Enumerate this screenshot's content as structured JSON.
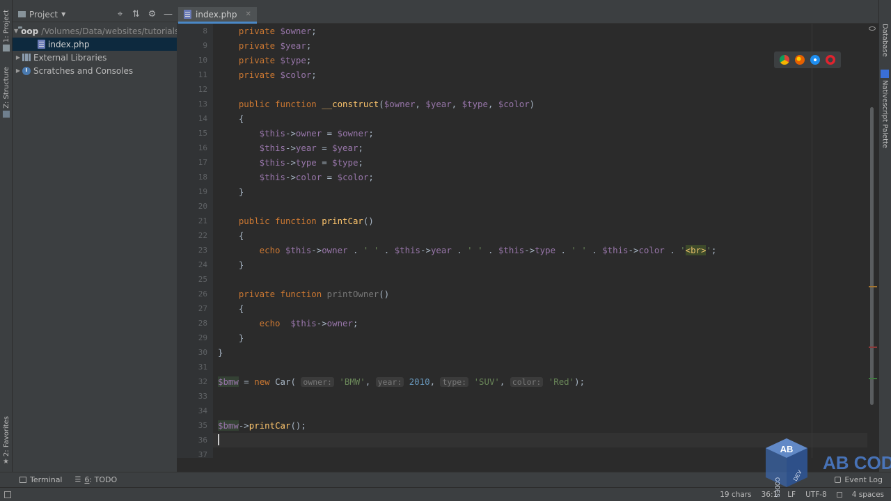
{
  "project_panel": {
    "title": "Project",
    "tree": [
      {
        "name": "oop",
        "path": "/Volumes/Data/websites/tutorials/",
        "type": "folder",
        "expanded": true
      },
      {
        "name": "index.php",
        "type": "php",
        "selected": true
      },
      {
        "name": "External Libraries",
        "type": "library"
      },
      {
        "name": "Scratches and Consoles",
        "type": "scratch"
      }
    ]
  },
  "left_strip": {
    "project_tab": "1: Project",
    "structure_tab": "Z: Structure",
    "favorites_tab": "2: Favorites"
  },
  "right_strip": {
    "database_tab": "Database",
    "nativescript_tab": "Nativescript Palette"
  },
  "editor": {
    "active_tab": "index.php",
    "current_line": 36,
    "lines": [
      {
        "n": "8",
        "tokens": [
          [
            "kw",
            "    private "
          ],
          [
            "var",
            "$owner"
          ],
          [
            "plain",
            ";"
          ]
        ]
      },
      {
        "n": "9",
        "tokens": [
          [
            "kw",
            "    private "
          ],
          [
            "var",
            "$year"
          ],
          [
            "plain",
            ";"
          ]
        ]
      },
      {
        "n": "10",
        "tokens": [
          [
            "kw",
            "    private "
          ],
          [
            "var",
            "$type"
          ],
          [
            "plain",
            ";"
          ]
        ]
      },
      {
        "n": "11",
        "tokens": [
          [
            "kw",
            "    private "
          ],
          [
            "var",
            "$color"
          ],
          [
            "plain",
            ";"
          ]
        ]
      },
      {
        "n": "12",
        "tokens": []
      },
      {
        "n": "13",
        "tokens": [
          [
            "kw",
            "    public function "
          ],
          [
            "fn",
            "__construct"
          ],
          [
            "plain",
            "("
          ],
          [
            "var",
            "$owner"
          ],
          [
            "plain",
            ", "
          ],
          [
            "var",
            "$year"
          ],
          [
            "plain",
            ", "
          ],
          [
            "var",
            "$type"
          ],
          [
            "plain",
            ", "
          ],
          [
            "var",
            "$color"
          ],
          [
            "plain",
            ")"
          ]
        ]
      },
      {
        "n": "14",
        "tokens": [
          [
            "plain",
            "    {"
          ]
        ]
      },
      {
        "n": "15",
        "tokens": [
          [
            "var",
            "        $this"
          ],
          [
            "plain",
            "->"
          ],
          [
            "var",
            "owner"
          ],
          [
            "plain",
            " = "
          ],
          [
            "var",
            "$owner"
          ],
          [
            "plain",
            ";"
          ]
        ]
      },
      {
        "n": "16",
        "tokens": [
          [
            "var",
            "        $this"
          ],
          [
            "plain",
            "->"
          ],
          [
            "var",
            "year"
          ],
          [
            "plain",
            " = "
          ],
          [
            "var",
            "$year"
          ],
          [
            "plain",
            ";"
          ]
        ]
      },
      {
        "n": "17",
        "tokens": [
          [
            "var",
            "        $this"
          ],
          [
            "plain",
            "->"
          ],
          [
            "var",
            "type"
          ],
          [
            "plain",
            " = "
          ],
          [
            "var",
            "$type"
          ],
          [
            "plain",
            ";"
          ]
        ]
      },
      {
        "n": "18",
        "tokens": [
          [
            "var",
            "        $this"
          ],
          [
            "plain",
            "->"
          ],
          [
            "var",
            "color"
          ],
          [
            "plain",
            " = "
          ],
          [
            "var",
            "$color"
          ],
          [
            "plain",
            ";"
          ]
        ]
      },
      {
        "n": "19",
        "tokens": [
          [
            "plain",
            "    }"
          ]
        ]
      },
      {
        "n": "20",
        "tokens": []
      },
      {
        "n": "21",
        "tokens": [
          [
            "kw",
            "    public function "
          ],
          [
            "fn",
            "printCar"
          ],
          [
            "plain",
            "()"
          ]
        ]
      },
      {
        "n": "22",
        "tokens": [
          [
            "plain",
            "    {"
          ]
        ]
      },
      {
        "n": "23",
        "tokens": [
          [
            "kw",
            "        echo "
          ],
          [
            "var",
            "$this"
          ],
          [
            "plain",
            "->"
          ],
          [
            "var",
            "owner"
          ],
          [
            "plain",
            " . "
          ],
          [
            "str",
            "' '"
          ],
          [
            "plain",
            " . "
          ],
          [
            "var",
            "$this"
          ],
          [
            "plain",
            "->"
          ],
          [
            "var",
            "year"
          ],
          [
            "plain",
            " . "
          ],
          [
            "str",
            "' '"
          ],
          [
            "plain",
            " . "
          ],
          [
            "var",
            "$this"
          ],
          [
            "plain",
            "->"
          ],
          [
            "var",
            "type"
          ],
          [
            "plain",
            " . "
          ],
          [
            "str",
            "' '"
          ],
          [
            "plain",
            " . "
          ],
          [
            "var",
            "$this"
          ],
          [
            "plain",
            "->"
          ],
          [
            "var",
            "color"
          ],
          [
            "plain",
            " . "
          ],
          [
            "str",
            "'"
          ],
          [
            "tag",
            "<br>"
          ],
          [
            "str",
            "'"
          ],
          [
            "plain",
            ";"
          ]
        ]
      },
      {
        "n": "24",
        "tokens": [
          [
            "plain",
            "    }"
          ]
        ]
      },
      {
        "n": "25",
        "tokens": []
      },
      {
        "n": "26",
        "tokens": [
          [
            "kw",
            "    private function "
          ],
          [
            "gray",
            "printOwner"
          ],
          [
            "plain",
            "()"
          ]
        ]
      },
      {
        "n": "27",
        "tokens": [
          [
            "plain",
            "    {"
          ]
        ]
      },
      {
        "n": "28",
        "tokens": [
          [
            "kw",
            "        echo  "
          ],
          [
            "var",
            "$this"
          ],
          [
            "plain",
            "->"
          ],
          [
            "var",
            "owner"
          ],
          [
            "plain",
            ";"
          ]
        ]
      },
      {
        "n": "29",
        "tokens": [
          [
            "plain",
            "    }"
          ]
        ]
      },
      {
        "n": "30",
        "tokens": [
          [
            "plain",
            "}"
          ]
        ]
      },
      {
        "n": "31",
        "tokens": []
      },
      {
        "n": "32",
        "tokens": [
          [
            "bmwvar",
            "$bmw"
          ],
          [
            "plain",
            " = "
          ],
          [
            "kw",
            "new "
          ],
          [
            "plain",
            "Car( "
          ],
          [
            "hint",
            "owner:"
          ],
          [
            "str",
            " 'BMW'"
          ],
          [
            "plain",
            ", "
          ],
          [
            "hint",
            "year:"
          ],
          [
            "num",
            " 2010"
          ],
          [
            "plain",
            ", "
          ],
          [
            "hint",
            "type:"
          ],
          [
            "str",
            " 'SUV'"
          ],
          [
            "plain",
            ", "
          ],
          [
            "hint",
            "color:"
          ],
          [
            "str",
            " 'Red'"
          ],
          [
            "plain",
            ");"
          ]
        ]
      },
      {
        "n": "33",
        "tokens": []
      },
      {
        "n": "34",
        "tokens": []
      },
      {
        "n": "35",
        "tokens": [
          [
            "bmwvar",
            "$bmw"
          ],
          [
            "plain",
            "->"
          ],
          [
            "fn",
            "printCar"
          ],
          [
            "plain",
            "();"
          ]
        ]
      },
      {
        "n": "36",
        "tokens": []
      },
      {
        "n": "37",
        "tokens": []
      }
    ]
  },
  "bottom_tools": {
    "terminal": "Terminal",
    "todo_prefix": "6",
    "todo": ": TODO",
    "event_log": "Event Log"
  },
  "status_bar": {
    "chars": "19 chars",
    "position": "36:1",
    "line_sep": "LF",
    "encoding": "UTF-8",
    "indent": "4 spaces"
  },
  "watermark": {
    "text": "AB CODES",
    "badge": "AB",
    "sub1": "CODES",
    "sub2": "DEV"
  },
  "colors": {
    "keyword": "#cc7832",
    "variable": "#9876aa",
    "function": "#ffc66d",
    "string": "#6a8759",
    "number": "#6897bb",
    "text": "#a9b7c6",
    "background": "#2b2b2b"
  }
}
